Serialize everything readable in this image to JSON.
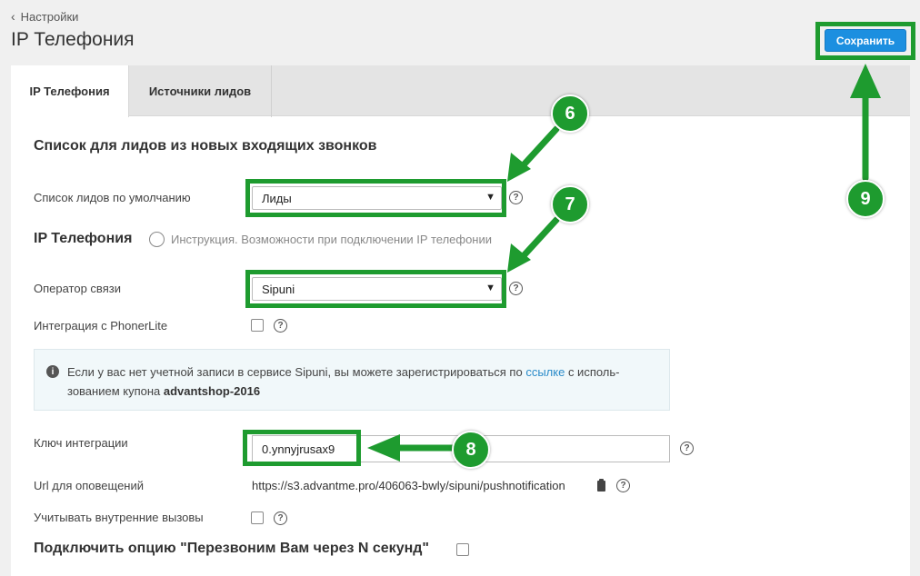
{
  "header": {
    "back_label": "Настройки",
    "title": "IP Телефония",
    "save_label": "Сохранить"
  },
  "tabs": [
    {
      "label": "IP Телефония",
      "active": true
    },
    {
      "label": "Источники лидов",
      "active": false
    }
  ],
  "leads_section": {
    "title": "Список для лидов из новых входящих звонков",
    "default_list_label": "Список лидов по умолчанию",
    "default_list_value": "Лиды"
  },
  "ip_section": {
    "title": "IP Телефония",
    "instruction_text": "Инструкция. Возможности при подключении IP телефонии",
    "operator_label": "Оператор связи",
    "operator_value": "Sipuni",
    "phonerlite_label": "Интеграция с PhonerLite",
    "phonerlite_checked": false
  },
  "info_box": {
    "text_before_link": "Если у вас нет учетной записи в сервисе Sipuni, вы можете зарегистрироваться по ",
    "link_text": "ссылке",
    "text_after_link": " с исполь-",
    "line2_prefix": "зованием купона ",
    "coupon": "advantshop-2016"
  },
  "integration": {
    "key_label": "Ключ интеграции",
    "key_value": "0.ynnyjrusax9",
    "url_label": "Url для оповещений",
    "url_value": "https://s3.advantme.pro/406063-bwly/sipuni/pushnotification",
    "internal_calls_label": "Учитывать внутренние вызовы",
    "internal_calls_checked": false
  },
  "callback_section": {
    "title": "Подключить опцию \"Перезвоним Вам через N секунд\"",
    "checked": false
  },
  "annotations": {
    "badges": [
      "6",
      "7",
      "8",
      "9"
    ],
    "color": "#1e9b2f"
  },
  "icons": {
    "back": "chevron-left-icon",
    "help": "question-circle-icon",
    "info": "info-circle-icon",
    "instruction": "speech-info-icon",
    "copy": "clipboard-icon"
  },
  "colors": {
    "accent": "#1c8fe0",
    "link": "#2a8bc9",
    "annotation_green": "#1e9b2f"
  }
}
